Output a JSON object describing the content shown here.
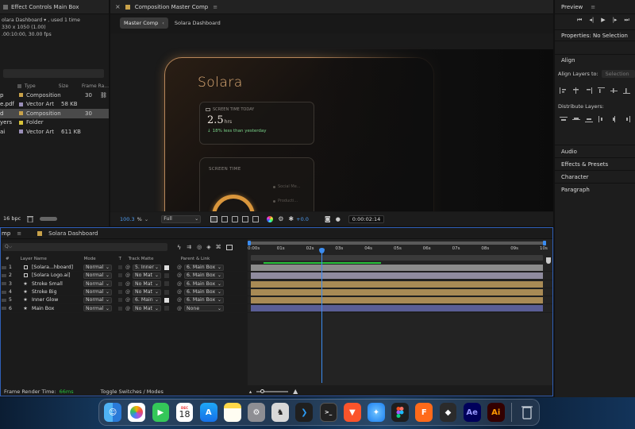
{
  "project_panel": {
    "title": "Effect Controls Main Box",
    "info": {
      "line1": "olara Dashboard ▾ , used 1 time",
      "line2": "330 x 1050 (1.00)",
      "line3": ".00:10:00, 30.00 fps"
    },
    "columns": {
      "type": "Type",
      "size": "Size",
      "framerate": "Frame Ra..."
    },
    "items": [
      {
        "name": "p",
        "type": "Composition",
        "size": "",
        "fps": "30",
        "color": "#c9a24a",
        "selected": false
      },
      {
        "name": "e.pdf",
        "type": "Vector Art",
        "size": "58 KB",
        "fps": "",
        "color": "#9a8fb8",
        "selected": false
      },
      {
        "name": "d",
        "type": "Composition",
        "size": "",
        "fps": "30",
        "color": "#c9a24a",
        "selected": true
      },
      {
        "name": "yers",
        "type": "Folder",
        "size": "",
        "fps": "",
        "color": "#d8c43a",
        "selected": false
      },
      {
        "name": "ai",
        "type": "Vector Art",
        "size": "611 KB",
        "fps": "",
        "color": "#9a8fb8",
        "selected": false
      }
    ],
    "bpc": "16 bpc"
  },
  "comp_panel": {
    "title": "Composition Master Comp",
    "breadcrumb_active": "Master Comp",
    "breadcrumb_next": "Solara Dashboard",
    "zoom": "100.3",
    "zoom_unit": "%",
    "resolution": "Full",
    "exposure": "+0.0",
    "timecode": "0:00:02:14"
  },
  "artwork": {
    "brand": "Solara",
    "card1_title": "SCREEN TIME TODAY",
    "card1_value": "2.5",
    "card1_unit": "hrs",
    "card1_delta": "18% less than yesterday",
    "card2_title": "SCREEN TIME",
    "legend1": "Social Me...",
    "legend2": "Producti..."
  },
  "right_panel": {
    "preview": "Preview",
    "properties": "Properties: No Selection",
    "align": "Align",
    "align_to_label": "Align Layers to:",
    "align_to_value": "Selection",
    "distribute": "Distribute Layers:",
    "sections": [
      "Audio",
      "Effects & Presets",
      "Character",
      "Paragraph"
    ]
  },
  "timeline": {
    "tab1": "mp",
    "tab2": "Solara Dashboard",
    "search_placeholder": "Q⌵",
    "headers": {
      "num": "#",
      "layer": "Layer Name",
      "mode": "Mode",
      "t": "T",
      "matte": "Track Matte",
      "parent": "Parent & Link"
    },
    "ruler": [
      "0:00s",
      "01s",
      "02s",
      "03s",
      "04s",
      "05s",
      "06s",
      "07s",
      "08s",
      "09s",
      "10s"
    ],
    "layers": [
      {
        "num": "1",
        "name": "[Solara...hboard]",
        "mode": "Normal",
        "matte": "5. Inner",
        "parent": "6. Main Box",
        "bar": "#8c8c8c",
        "star": false
      },
      {
        "num": "2",
        "name": "[Solara Logo.ai]",
        "mode": "Normal",
        "matte": "No Mat",
        "parent": "6. Main Box",
        "bar": "#8f8b9e",
        "star": false
      },
      {
        "num": "3",
        "name": "Stroke Small",
        "mode": "Normal",
        "matte": "No Mat",
        "parent": "6. Main Box",
        "bar": "#a88a55",
        "star": true
      },
      {
        "num": "4",
        "name": "Stroke Big",
        "mode": "Normal",
        "matte": "No Mat",
        "parent": "6. Main Box",
        "bar": "#a88a55",
        "star": true
      },
      {
        "num": "5",
        "name": "Inner Glow",
        "mode": "Normal",
        "matte": "6. Main",
        "parent": "6. Main Box",
        "bar": "#a88a55",
        "star": true
      },
      {
        "num": "6",
        "name": "Main Box",
        "mode": "Normal",
        "matte": "No Mat",
        "parent": "None",
        "bar": "#5a5e96",
        "star": true
      }
    ],
    "frame_render_label": "Frame Render Time:",
    "frame_render_value": "66ms",
    "toggle_label": "Toggle Switches / Modes"
  },
  "dock": {
    "calendar_month": "DEC",
    "calendar_day": "18",
    "apps": [
      "finder",
      "photos",
      "facetime",
      "calendar",
      "app-store",
      "notes",
      "system-settings",
      "reader",
      "vscode",
      "terminal",
      "brave",
      "safari",
      "figma",
      "fss",
      "blender",
      "after-effects",
      "illustrator",
      "trash"
    ],
    "ae_label": "Ae",
    "ai_label": "Ai",
    "fss_label": "F"
  },
  "colors": {
    "accent_blue": "#3b8cf0",
    "gold": "#d9a65a",
    "green": "#27c23a"
  }
}
